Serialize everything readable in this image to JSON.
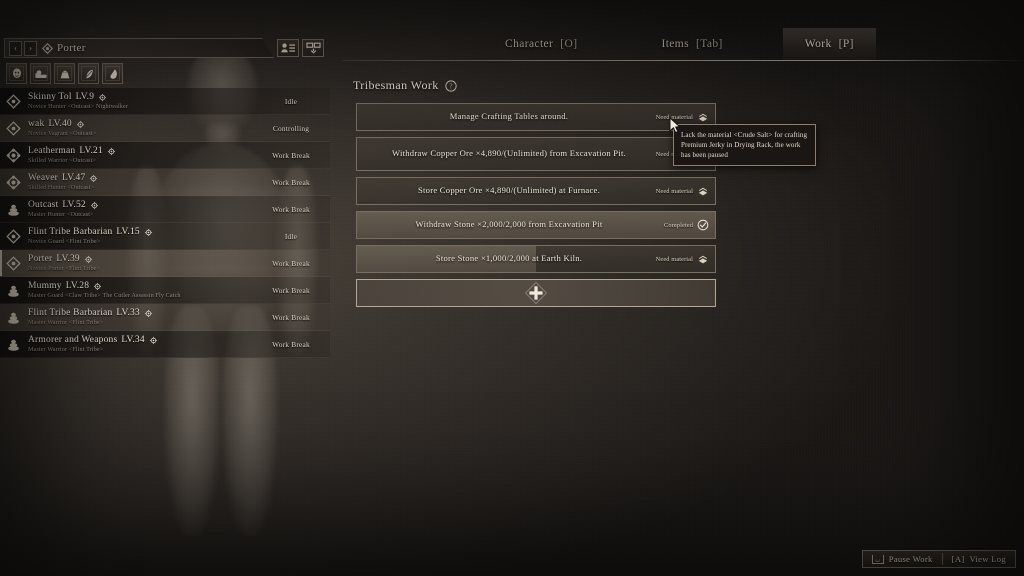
{
  "header": {
    "prev_label": "‹",
    "next_label": "›",
    "character_name": "Porter",
    "rank_icon": "diamond-rank-icon",
    "roster_icon": "roster-list-icon",
    "grid_icon": "grid-view-icon"
  },
  "filters": [
    {
      "name": "filter-face-icon",
      "label": "Face"
    },
    {
      "name": "filter-rest-icon",
      "label": "Rest"
    },
    {
      "name": "filter-weight-icon",
      "label": "Weight"
    },
    {
      "name": "filter-food-icon",
      "label": "Food"
    },
    {
      "name": "filter-animal-icon",
      "label": "Animal"
    }
  ],
  "character_list": [
    {
      "name": "Skinny Tol",
      "level": "LV.9",
      "subtitle": "Novice Hunter <Outcast>  Nightwalker",
      "status": "Idle",
      "rank": "novice",
      "selected": false,
      "shade": "dark"
    },
    {
      "name": "wak",
      "level": "LV.40",
      "subtitle": "Novice Vagrant <Outcast>",
      "status": "Controlling",
      "rank": "novice",
      "selected": false,
      "shade": "shade"
    },
    {
      "name": "Leatherman",
      "level": "LV.21",
      "subtitle": "Skilled Warrior <Outcast>",
      "status": "Work Break",
      "rank": "skilled",
      "selected": false,
      "shade": "dark"
    },
    {
      "name": "Weaver",
      "level": "LV.47",
      "subtitle": "Skilled Hunter <Outcast>",
      "status": "Work Break",
      "rank": "skilled",
      "selected": false,
      "shade": "shade"
    },
    {
      "name": "Outcast",
      "level": "LV.52",
      "subtitle": "Master Hunter <Outcast>",
      "status": "Work Break",
      "rank": "master",
      "selected": false,
      "shade": "dark"
    },
    {
      "name": "Flint Tribe Barbarian",
      "level": "LV.15",
      "subtitle": "Novice Guard <Flint Tribe>",
      "status": "Idle",
      "rank": "novice",
      "selected": false,
      "shade": "dark"
    },
    {
      "name": "Porter",
      "level": "LV.39",
      "subtitle": "Novice Porter <Flint Tribe>",
      "status": "Work Break",
      "rank": "novice",
      "selected": true,
      "shade": "shade"
    },
    {
      "name": "Mummy",
      "level": "LV.28",
      "subtitle": "Master Guard <Claw Tribe>  The Cutler Assassin  Fly Catch",
      "status": "Work Break",
      "rank": "master",
      "selected": false,
      "shade": "dark"
    },
    {
      "name": "Flint Tribe Barbarian",
      "level": "LV.33",
      "subtitle": "Master Warrior <Flint Tribe>",
      "status": "Work Break",
      "rank": "master",
      "selected": false,
      "shade": "shade"
    },
    {
      "name": "Armorer and Weapons",
      "level": "LV.34",
      "subtitle": "Master Warrior <Flint Tribe>",
      "status": "Work Break",
      "rank": "master",
      "selected": false,
      "shade": "dark"
    }
  ],
  "tabs": [
    {
      "label": "Character",
      "key": "[O]",
      "active": false
    },
    {
      "label": "Items",
      "key": "[Tab]",
      "active": false
    },
    {
      "label": "Work",
      "key": "[P]",
      "active": true
    }
  ],
  "work": {
    "title": "Tribesman Work",
    "help_icon": "help-question-icon",
    "add_task_icon": "plus-add-icon",
    "tasks": [
      {
        "label": "Manage Crafting Tables around.",
        "state": "Need material",
        "state_icon": "need-material-icon",
        "progress_pct": 0,
        "tall": false
      },
      {
        "label": "Withdraw Copper Ore ×4,890/(Unlimited) from Excavation Pit.",
        "state": "Need material",
        "state_icon": "need-material-icon",
        "progress_pct": 0,
        "tall": true
      },
      {
        "label": "Store Copper Ore ×4,890/(Unlimited) at Furnace.",
        "state": "Need material",
        "state_icon": "need-material-icon",
        "progress_pct": 0,
        "tall": false
      },
      {
        "label": "Withdraw Stone ×2,000/2,000 from Excavation Pit",
        "state": "Completed",
        "state_icon": "completed-check-icon",
        "progress_pct": 100,
        "tall": false
      },
      {
        "label": "Store Stone ×1,000/2,000 at Earth Kiln.",
        "state": "Need material",
        "state_icon": "need-material-icon",
        "progress_pct": 50,
        "tall": false
      }
    ]
  },
  "tooltip": {
    "text": "Lack the material <Crude Salt> for crafting Premium Jerky in Drying Rack, the work has been paused"
  },
  "bottom": {
    "pause_key": "␣",
    "pause_label": "Pause Work",
    "log_key": "[A]",
    "log_label": "View Log"
  },
  "colors": {
    "panel_bg": "#3a332e",
    "accent_border": "#7a6e61",
    "text_primary": "#efe8da",
    "text_muted": "#9c9083"
  }
}
